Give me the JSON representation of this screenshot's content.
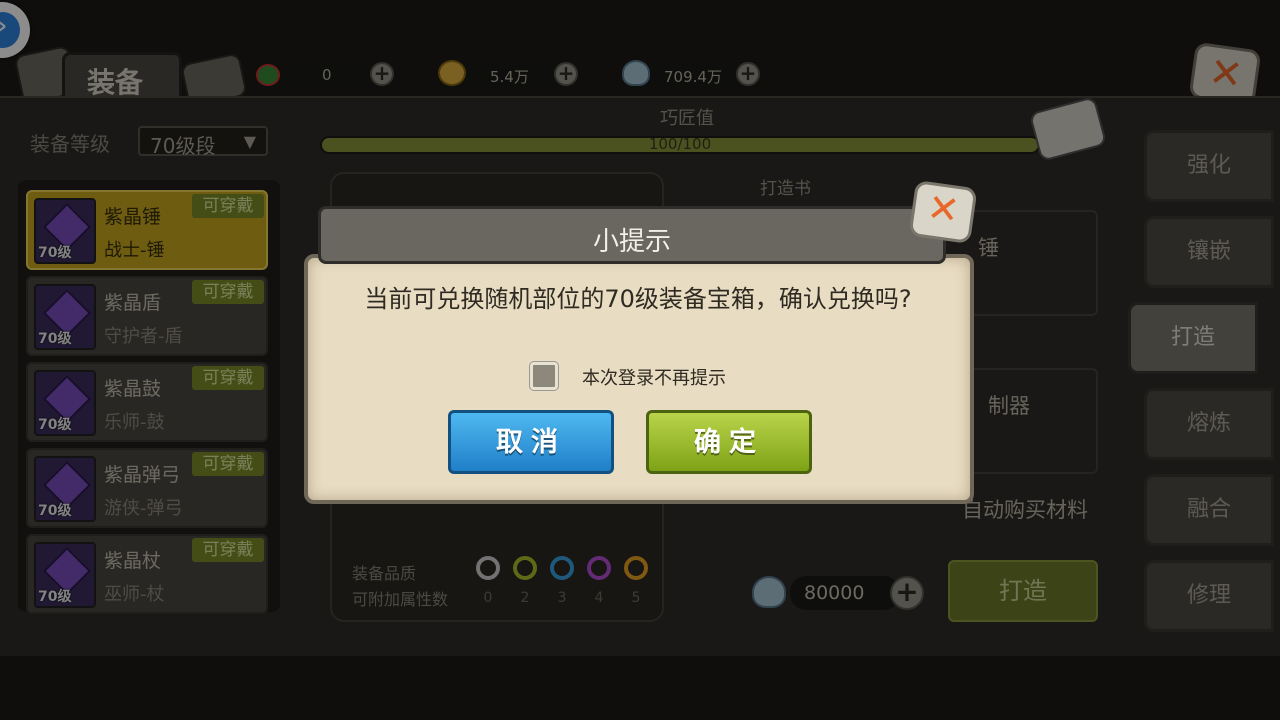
{
  "header": {
    "title": "装备",
    "resources": [
      {
        "icon": "clover-icon",
        "value": "0"
      },
      {
        "icon": "gold-coin-icon",
        "value": "5.4万"
      },
      {
        "icon": "shell-icon",
        "value": "709.4万"
      }
    ]
  },
  "filter": {
    "label": "装备等级",
    "selected": "70级段"
  },
  "equipment": [
    {
      "name": "紫晶锤",
      "class": "战士-锤",
      "level": "70级",
      "badge": "可穿戴"
    },
    {
      "name": "紫晶盾",
      "class": "守护者-盾",
      "level": "70级",
      "badge": "可穿戴"
    },
    {
      "name": "紫晶鼓",
      "class": "乐师-鼓",
      "level": "70级",
      "badge": "可穿戴"
    },
    {
      "name": "紫晶弹弓",
      "class": "游侠-弹弓",
      "level": "70级",
      "badge": "可穿戴"
    },
    {
      "name": "紫晶杖",
      "class": "巫师-杖",
      "level": "70级",
      "badge": "可穿戴"
    }
  ],
  "craft": {
    "label": "巧匠值",
    "value": "100/100",
    "progress_fraction": 1.0,
    "book_label": "打造书",
    "book_partial": "锤",
    "tool_partial": "制器",
    "auto_buy": "自动购买材料",
    "cost": "80000",
    "forge_button": "打造"
  },
  "quality": {
    "label": "装备品质",
    "attr_label": "可附加属性数",
    "levels": [
      "0",
      "2",
      "3",
      "4",
      "5"
    ],
    "colors": [
      "#d0d0d0",
      "#a8c22a",
      "#3aa0e0",
      "#b44fd6",
      "#e8a020"
    ]
  },
  "tabs": [
    "强化",
    "镶嵌",
    "打造",
    "熔炼",
    "融合",
    "修理"
  ],
  "active_tab": "打造",
  "dialog": {
    "title": "小提示",
    "message": "当前可兑换随机部位的70级装备宝箱，确认兑换吗?",
    "checkbox_label": "本次登录不再提示",
    "checkbox_checked": false,
    "cancel": "取消",
    "confirm": "确定"
  },
  "colors": {
    "accent_orange": "#e7682a",
    "progress_green": "#89953b",
    "cancel_blue": "#2f8fd6",
    "confirm_green": "#97b82a"
  }
}
